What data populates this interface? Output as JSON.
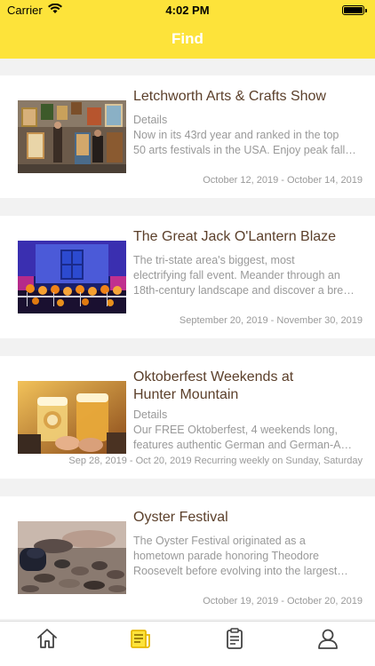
{
  "status_bar": {
    "carrier": "Carrier",
    "time": "4:02 PM",
    "battery_level": 1.0
  },
  "nav": {
    "title": "Find"
  },
  "colors": {
    "accent": "#fde33a",
    "title_text": "#5b3f2a",
    "muted_text": "#999999",
    "tab_active": "#e6b800",
    "tab_inactive": "#444444"
  },
  "events": [
    {
      "title": "Letchworth Arts & Crafts Show",
      "desc_lines": [
        "Details",
        "Now in its 43rd year and ranked in the top",
        "50 arts festivals in the USA. Enjoy peak fall…"
      ],
      "date": "October 12, 2019 - October 14, 2019",
      "image": "art-gallery-photo"
    },
    {
      "title": "The Great Jack O'Lantern Blaze",
      "desc_lines": [
        "The tri-state area's biggest, most",
        "electrifying fall event. Meander through an",
        "18th-century landscape and discover a bre…"
      ],
      "date": "September 20, 2019 - November 30, 2019",
      "image": "jack-o-lantern-photo"
    },
    {
      "title_lines": [
        "Oktoberfest Weekends at",
        "Hunter Mountain"
      ],
      "desc_lines": [
        "Details",
        "Our FREE Oktoberfest, 4 weekends long,",
        "features authentic German and German-A…"
      ],
      "date": "Sep 28, 2019 - Oct 20, 2019 Recurring weekly on Sunday, Saturday",
      "image": "beer-toast-photo"
    },
    {
      "title": "Oyster Festival",
      "desc_lines": [
        "The Oyster Festival originated as a",
        "hometown parade honoring Theodore",
        "Roosevelt before evolving into the largest…"
      ],
      "date": "October 19, 2019 - October 20, 2019",
      "image": "oysters-photo"
    }
  ],
  "tabs": [
    {
      "icon": "home-icon",
      "active": false
    },
    {
      "icon": "news-icon",
      "active": true
    },
    {
      "icon": "clipboard-icon",
      "active": false
    },
    {
      "icon": "profile-icon",
      "active": false
    }
  ]
}
